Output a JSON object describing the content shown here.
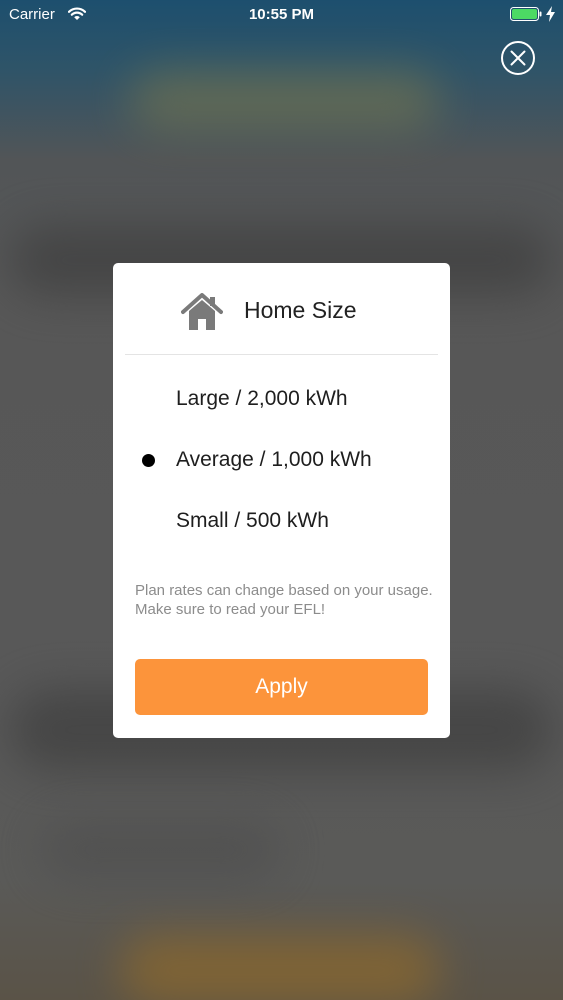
{
  "status_bar": {
    "carrier": "Carrier",
    "time": "10:55 PM",
    "icons": [
      "wifi-icon",
      "battery-icon",
      "charging-bolt-icon"
    ]
  },
  "close_button": {
    "icon": "close-circle-icon"
  },
  "modal": {
    "icon": "house-icon",
    "title": "Home Size",
    "options": [
      {
        "label": "Large / 2,000 kWh",
        "selected": false
      },
      {
        "label": "Average / 1,000 kWh",
        "selected": true
      },
      {
        "label": "Small / 500 kWh",
        "selected": false
      }
    ],
    "notice": "Plan rates can change based on your usage. Make sure to read your EFL!",
    "apply_label": "Apply"
  },
  "colors": {
    "accent": "#fc943b",
    "battery": "#4cd964",
    "icon_gray": "#7a7a7a",
    "notice_text": "#8c8c8c"
  }
}
